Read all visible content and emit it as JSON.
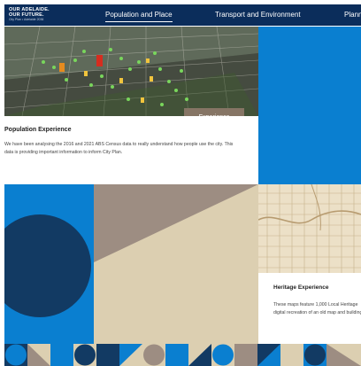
{
  "brand": {
    "line1": "OUR ADELAIDE.",
    "line2": "OUR FUTURE.",
    "sub": "City Plan • Adelaide 2036"
  },
  "nav": {
    "items": [
      {
        "label": "Population and Place",
        "active": true
      },
      {
        "label": "Transport and Environment",
        "active": false
      },
      {
        "label": "Planning",
        "active": false
      }
    ]
  },
  "population": {
    "title": "Population Experience",
    "body": "We have been analysing the 2016 and 2021 ABS Census data to really understand how people use the city. This data is providing important information to inform City Plan.",
    "button_label": "Experience"
  },
  "heritage": {
    "title": "Heritage Experience",
    "body_line1": "These maps feature 1,000 Local Heritage",
    "body_line2": "digital recreation of an old map and building"
  },
  "colors": {
    "nav_bg": "#0b2d5b",
    "accent_blue": "#0a7fd0",
    "navy": "#123a63",
    "sand": "#dccfb1",
    "taupe": "#9d8d82",
    "button_brown": "#867565"
  }
}
